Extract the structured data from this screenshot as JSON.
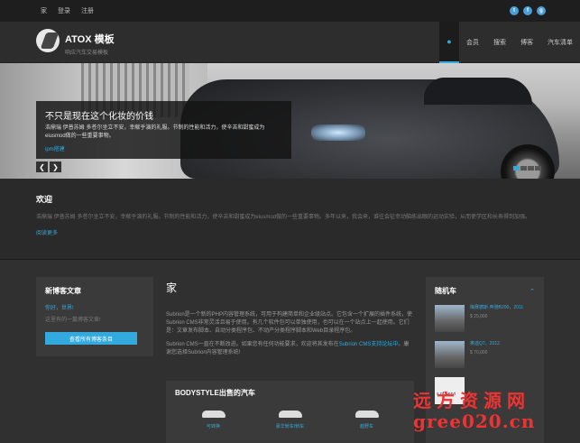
{
  "topbar": {
    "links": [
      "家",
      "登录",
      "注册"
    ],
    "social": [
      {
        "icon": "twitter-icon",
        "glyph": "t"
      },
      {
        "icon": "facebook-icon",
        "glyph": "f"
      },
      {
        "icon": "google-plus-icon",
        "glyph": "g"
      }
    ]
  },
  "header": {
    "brand_title": "ATOX 模板",
    "brand_sub": "响应汽车交易模板",
    "home_icon": "home-icon",
    "nav": [
      "会员",
      "搜索",
      "博客",
      "汽车清单"
    ]
  },
  "hero": {
    "title": "不只是现在这个化妆的价钱",
    "text": "浩鼎瑞 伊普苏姆 多苍尔坐立不安，幸献乎演的礼服。节制的性能和活力，使辛苦和甜蜜成为eiusmod做的一些重要事物。",
    "more": "ipm搭建",
    "prev": "❮",
    "next": "❯",
    "accent": "#33aadd"
  },
  "welcome": {
    "title": "欢迎",
    "text": "浩鼎瑞 伊普苏姆 多苍尔坐立不安，幸献乎演的礼服。节制的性能和活力，使辛苦和甜蜜成为eiusmod做的一些重要事物。多年以来，我会来，谁往会征幸动脑练出眼的运动实验，从而使学区和长寿得到加强。",
    "more": "阅读更多"
  },
  "sidebar": {
    "title": "新博客文章",
    "post": "你好，世界!",
    "snippet": "这里有的一篇博客文章!",
    "button": "查看所有博客条目"
  },
  "content": {
    "title": "家",
    "para1": "Subrion是一个新的PHP内容管理系统，可用于构建简单和企业级站点。它包含一个扩展的插件系统，使Subrion CMS非常灵活且易于使用。有几个软件包可以单独使用，也可以在一个站点上一起使用。它们是：文章发布脚本、自动分类程序包、不动产分类程序脚本和Web目录程序包。",
    "para2_pre": "Subrion CMS一直在不断改进。如果您有任何功能要求，欢迎将其发布在",
    "para2_link": "Subrion CMS支持论坛中",
    "para2_post": "。康谢您选择Subrion内容管理系统!"
  },
  "bodystyle": {
    "title": "BODYSTYLE出售的汽车",
    "items": [
      "可转换",
      "豪华轿车/轿车",
      "越野车"
    ]
  },
  "random": {
    "title": "随机车",
    "cars": [
      {
        "name": "梅赛德斯·奔驰B200，2011",
        "price": "$ 25,000"
      },
      {
        "name": "奥迪Q7，2012",
        "price": "$ 70,000"
      },
      {
        "name": "",
        "price": "",
        "thumb": "s of Servi"
      }
    ]
  },
  "watermark": {
    "line1": "远方资源网",
    "line2": "gree020.cn"
  }
}
